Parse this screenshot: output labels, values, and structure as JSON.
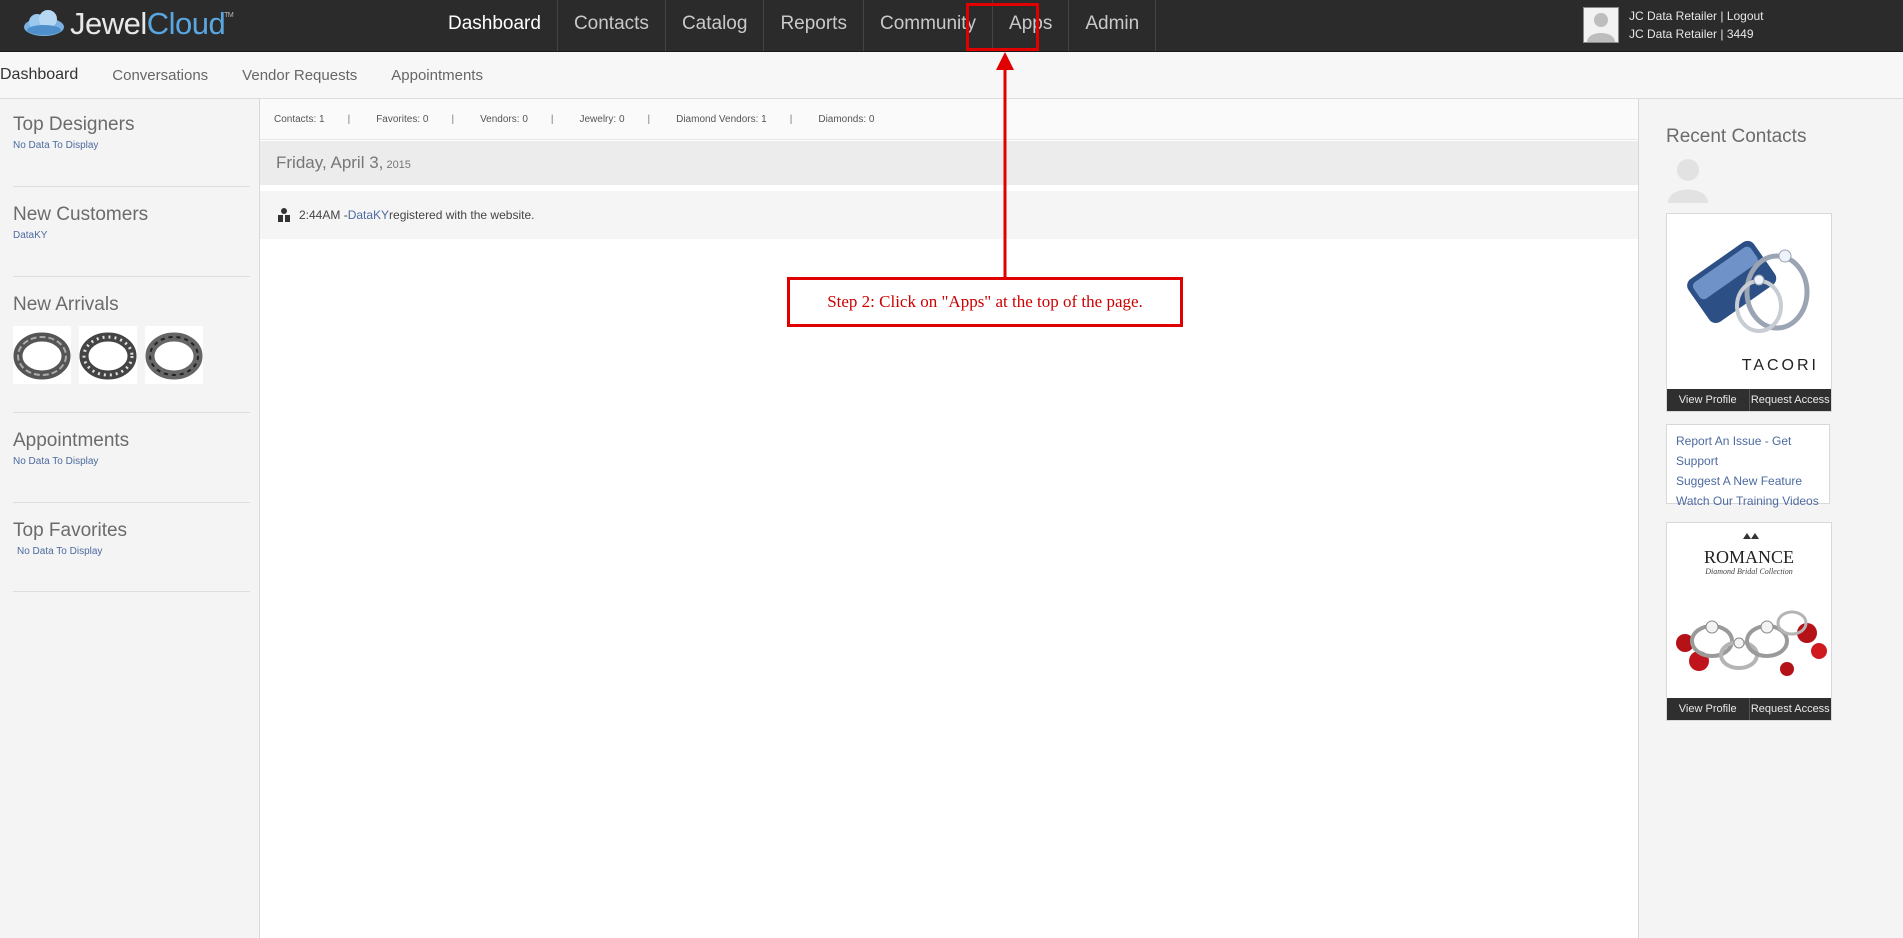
{
  "app": {
    "logo_part1": "Jewel",
    "logo_part2": "Cloud",
    "logo_tm": "TM"
  },
  "nav": {
    "items": [
      "Dashboard",
      "Contacts",
      "Catalog",
      "Reports",
      "Community",
      "Apps",
      "Admin"
    ]
  },
  "user": {
    "line1": "JC Data Retailer | Logout",
    "line2": "JC Data Retailer | 3449"
  },
  "subnav": {
    "items": [
      "Dashboard",
      "Conversations",
      "Vendor Requests",
      "Appointments"
    ]
  },
  "left": {
    "top_designers": {
      "title": "Top Designers",
      "text": "No Data To Display"
    },
    "new_customers": {
      "title": "New Customers",
      "text": "DataKY"
    },
    "new_arrivals": {
      "title": "New Arrivals"
    },
    "appointments": {
      "title": "Appointments",
      "text": "No Data To Display"
    },
    "top_favorites": {
      "title": "Top Favorites",
      "text": "No Data To Display"
    }
  },
  "stats": {
    "contacts": "Contacts: 1",
    "favorites": "Favorites: 0",
    "vendors": "Vendors: 0",
    "jewelry": "Jewelry: 0",
    "diamond_vendors": "Diamond Vendors: 1",
    "diamonds": "Diamonds: 0",
    "separator": "|"
  },
  "feed": {
    "date_main": "Friday, April 3,",
    "date_year": " 2015",
    "time": "2:44AM - ",
    "user": "DataKY",
    "text": " registered with the website."
  },
  "right": {
    "title": "Recent Contacts",
    "vendor1": {
      "brand": "TACORI",
      "view": "View Profile",
      "request": "Request Access"
    },
    "links": [
      "Report An Issue - Get Support",
      "Suggest A New Feature",
      "Watch Our Training Videos"
    ],
    "vendor2": {
      "brand": "ROMANCE",
      "tagline": "Diamond Bridal Collection",
      "view": "View Profile",
      "request": "Request Access"
    }
  },
  "annotation": {
    "text": "Step 2: Click on \"Apps\" at the top of the page.",
    "color": "#e00000"
  }
}
